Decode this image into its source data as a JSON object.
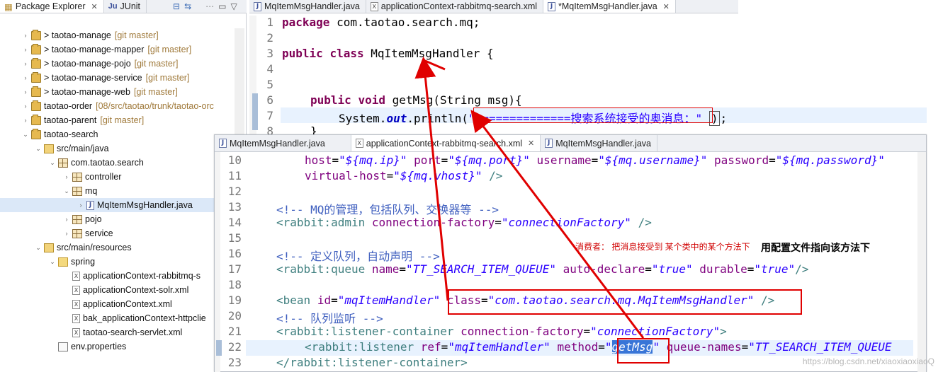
{
  "explorer": {
    "tabs": [
      "Package Explorer",
      "JUnit"
    ],
    "tree": [
      {
        "arrow": ">",
        "label": "> taotao-manage",
        "git": "[git master]",
        "icon": "project"
      },
      {
        "arrow": ">",
        "label": "> taotao-manage-mapper",
        "git": "[git master]",
        "icon": "project"
      },
      {
        "arrow": ">",
        "label": "> taotao-manage-pojo",
        "git": "[git master]",
        "icon": "project"
      },
      {
        "arrow": ">",
        "label": "> taotao-manage-service",
        "git": "[git master]",
        "icon": "project"
      },
      {
        "arrow": ">",
        "label": "> taotao-manage-web",
        "git": "[git master]",
        "icon": "project"
      },
      {
        "arrow": ">",
        "label": "taotao-order",
        "git": "[08/src/taotao/trunk/taotao-orc",
        "icon": "project"
      },
      {
        "arrow": ">",
        "label": "taotao-parent",
        "git": "[git master]",
        "icon": "project"
      },
      {
        "arrow": "v",
        "label": "taotao-search",
        "git": "",
        "icon": "project"
      },
      {
        "arrow": "v",
        "label": "src/main/java",
        "git": "",
        "icon": "source-folder"
      },
      {
        "arrow": "v",
        "label": "com.taotao.search",
        "git": "",
        "icon": "package"
      },
      {
        "arrow": ">",
        "label": "controller",
        "git": "",
        "icon": "package"
      },
      {
        "arrow": "v",
        "label": "mq",
        "git": "",
        "icon": "package"
      },
      {
        "arrow": ">",
        "label": "MqItemMsgHandler.java",
        "git": "",
        "icon": "java-file"
      },
      {
        "arrow": ">",
        "label": "pojo",
        "git": "",
        "icon": "package"
      },
      {
        "arrow": ">",
        "label": "service",
        "git": "",
        "icon": "package"
      },
      {
        "arrow": "v",
        "label": "src/main/resources",
        "git": "",
        "icon": "source-folder"
      },
      {
        "arrow": "v",
        "label": "spring",
        "git": "",
        "icon": "folder"
      },
      {
        "arrow": "",
        "label": "applicationContext-rabbitmq-s",
        "git": "",
        "icon": "xml-file"
      },
      {
        "arrow": "",
        "label": "applicationContext-solr.xml",
        "git": "",
        "icon": "xml-file"
      },
      {
        "arrow": "",
        "label": "applicationContext.xml",
        "git": "",
        "icon": "xml-file"
      },
      {
        "arrow": "",
        "label": "bak_applicationContext-httpclie",
        "git": "",
        "icon": "xml-file"
      },
      {
        "arrow": "",
        "label": "taotao-search-servlet.xml",
        "git": "",
        "icon": "xml-file"
      },
      {
        "arrow": "",
        "label": "env.properties",
        "git": "",
        "icon": "properties-file"
      }
    ]
  },
  "editor_top": {
    "tabs": [
      "MqItemMsgHandler.java",
      "applicationContext-rabbitmq-search.xml",
      "*MqItemMsgHandler.java"
    ],
    "line_numbers": [
      "1",
      "2",
      "3",
      "4",
      "5",
      "6",
      "7",
      "8"
    ]
  },
  "editor_xml": {
    "tabs": [
      "MqItemMsgHandler.java",
      "applicationContext-rabbitmq-search.xml",
      "MqItemMsgHandler.java"
    ],
    "line_numbers": [
      "10",
      "11",
      "12",
      "13",
      "14",
      "15",
      "16",
      "17",
      "18",
      "19",
      "20",
      "21",
      "22",
      "23"
    ]
  },
  "annotations": {
    "consumer_note": "消费者： 把消息接受到 某个类中的某个方法下",
    "config_note": "用配置文件指向该方法下"
  },
  "watermark": "https://blog.csdn.net/xiaoxiaoxiaoQ"
}
